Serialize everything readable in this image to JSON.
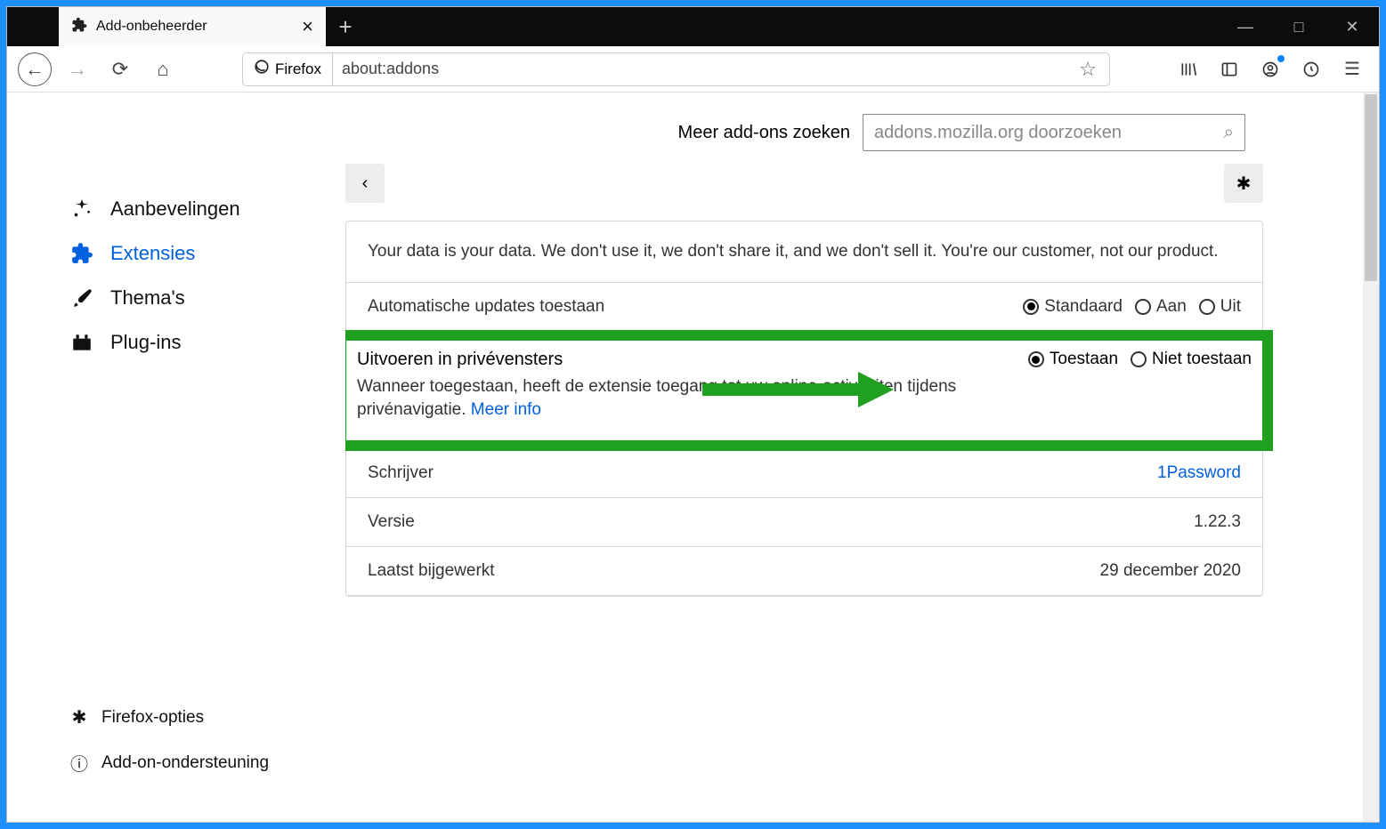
{
  "window": {
    "tab_title": "Add-onbeheerder",
    "min_label": "—",
    "max_label": "□",
    "close_label": "✕"
  },
  "toolbar": {
    "identity_label": "Firefox",
    "url": "about:addons"
  },
  "search_header": {
    "label": "Meer add-ons zoeken",
    "placeholder": "addons.mozilla.org doorzoeken"
  },
  "sidebar": {
    "items": [
      {
        "label": "Aanbevelingen"
      },
      {
        "label": "Extensies"
      },
      {
        "label": "Thema's"
      },
      {
        "label": "Plug-ins"
      }
    ],
    "footer": [
      {
        "label": "Firefox-opties"
      },
      {
        "label": "Add-on-ondersteuning"
      }
    ]
  },
  "detail": {
    "description": "Your data is your data. We don't use it, we don't share it, and we don't sell it. You're our customer, not our product.",
    "auto_updates": {
      "label": "Automatische updates toestaan",
      "options": {
        "default": "Standaard",
        "on": "Aan",
        "off": "Uit"
      },
      "selected": "default"
    },
    "private": {
      "label": "Uitvoeren in privévensters",
      "options": {
        "allow": "Toestaan",
        "deny": "Niet toestaan"
      },
      "selected": "allow",
      "note_a": "Wanneer toegestaan, heeft de extensie toegang tot uw online-activiteiten tijdens privénavigatie. ",
      "note_link": "Meer info"
    },
    "author_label": "Schrijver",
    "author_value": "1Password",
    "version_label": "Versie",
    "version_value": "1.22.3",
    "updated_label": "Laatst bijgewerkt",
    "updated_value": "29 december 2020"
  }
}
